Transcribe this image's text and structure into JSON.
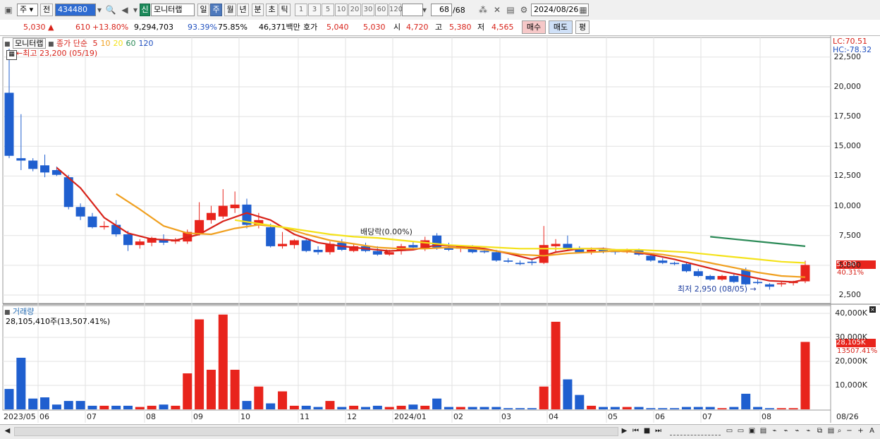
{
  "toolbar": {
    "period": "주",
    "prev_label": "전",
    "code": "434480",
    "market_badge": "신",
    "stock_name": "모니터랩",
    "tabs": [
      {
        "label": "일",
        "selected": false
      },
      {
        "label": "주",
        "selected": true
      },
      {
        "label": "월",
        "selected": false
      },
      {
        "label": "년",
        "selected": false
      },
      {
        "label": "분",
        "selected": false
      },
      {
        "label": "초",
        "selected": false
      },
      {
        "label": "틱",
        "selected": false
      }
    ],
    "intervals": [
      "1",
      "3",
      "5",
      "10",
      "20",
      "30",
      "60",
      "120"
    ],
    "count": "68",
    "total": "/68",
    "date": "2024/08/26"
  },
  "quote": {
    "price": "5,030",
    "change": "610",
    "change_pct": "+13.80%",
    "volume": "9,294,703",
    "pct1": "93.39%",
    "pct2": "75.85%",
    "amount": "46,371백만",
    "ask_label": "호가",
    "ask1": "5,040",
    "ask2": "5,030",
    "open_label": "시",
    "open": "4,720",
    "high_label": "고",
    "high": "5,380",
    "low_label": "저",
    "low": "4,565",
    "buy_label": "매수",
    "sell_label": "매도",
    "flat_label": "평"
  },
  "price_panel": {
    "name": "모니터랩",
    "legend_prefix": "종가 단순",
    "ma_labels": [
      "5",
      "10",
      "20",
      "60",
      "120"
    ],
    "ma_colors": [
      "#d8231a",
      "#f0a020",
      "#f4e21a",
      "#2b8a57",
      "#1f4fbf"
    ],
    "high_note": "최고 23,200 (05/19)",
    "low_note": "최저 2,950 (08/05)",
    "dividend_note": "배당락(0.00%)",
    "lc": "LC:70.51",
    "hc": "HC:-78.32",
    "last_price_tag": "5,030",
    "last_pct_tag": "40.31%",
    "yticks": [
      "22,500",
      "20,000",
      "17,500",
      "15,000",
      "12,500",
      "10,000",
      "7,500",
      "5,000",
      "2,500"
    ]
  },
  "volume_panel": {
    "title": "거래량",
    "summary": "28,105,410주(13,507.41%)",
    "yticks": [
      "40,000K",
      "30,000K",
      "20,000K",
      "10,000K"
    ],
    "last_vol_tag": "28,105K",
    "last_pct_tag": "13507.41%"
  },
  "xaxis": [
    "2023/05",
    "06",
    "07",
    "08",
    "09",
    "10",
    "11",
    "12",
    "2024/01",
    "02",
    "03",
    "04",
    "05",
    "06",
    "07",
    "08",
    "08/26"
  ],
  "chart_data": {
    "type": "candlestick",
    "y_range": [
      1700,
      23500
    ],
    "candles": [
      {
        "o": 19500,
        "h": 23200,
        "l": 14000,
        "c": 14200
      },
      {
        "o": 14000,
        "h": 17700,
        "l": 13000,
        "c": 13800
      },
      {
        "o": 13800,
        "h": 14000,
        "l": 12900,
        "c": 13100
      },
      {
        "o": 13400,
        "h": 14300,
        "l": 12400,
        "c": 12800
      },
      {
        "o": 13000,
        "h": 13300,
        "l": 12500,
        "c": 12600
      },
      {
        "o": 12400,
        "h": 12600,
        "l": 9700,
        "c": 9900
      },
      {
        "o": 9900,
        "h": 10200,
        "l": 8800,
        "c": 9100
      },
      {
        "o": 9100,
        "h": 9400,
        "l": 8100,
        "c": 8200
      },
      {
        "o": 8200,
        "h": 8700,
        "l": 8000,
        "c": 8300
      },
      {
        "o": 8400,
        "h": 8800,
        "l": 7400,
        "c": 7600
      },
      {
        "o": 7600,
        "h": 7900,
        "l": 6200,
        "c": 6700
      },
      {
        "o": 6700,
        "h": 7200,
        "l": 6400,
        "c": 7000
      },
      {
        "o": 6900,
        "h": 7400,
        "l": 6600,
        "c": 7300
      },
      {
        "o": 7200,
        "h": 7600,
        "l": 6700,
        "c": 6900
      },
      {
        "o": 7000,
        "h": 7300,
        "l": 6800,
        "c": 7100
      },
      {
        "o": 7000,
        "h": 8000,
        "l": 6800,
        "c": 7800
      },
      {
        "o": 7700,
        "h": 10300,
        "l": 7500,
        "c": 8800
      },
      {
        "o": 8800,
        "h": 10000,
        "l": 8500,
        "c": 9400
      },
      {
        "o": 9100,
        "h": 11400,
        "l": 8900,
        "c": 10000
      },
      {
        "o": 9800,
        "h": 11200,
        "l": 9400,
        "c": 10100
      },
      {
        "o": 10100,
        "h": 10600,
        "l": 8100,
        "c": 8400
      },
      {
        "o": 8400,
        "h": 9400,
        "l": 8100,
        "c": 8800
      },
      {
        "o": 8200,
        "h": 8500,
        "l": 6500,
        "c": 6600
      },
      {
        "o": 6600,
        "h": 7800,
        "l": 6400,
        "c": 6800
      },
      {
        "o": 6700,
        "h": 7200,
        "l": 6400,
        "c": 7100
      },
      {
        "o": 7100,
        "h": 7300,
        "l": 6100,
        "c": 6200
      },
      {
        "o": 6300,
        "h": 6600,
        "l": 5900,
        "c": 6100
      },
      {
        "o": 6100,
        "h": 7000,
        "l": 5900,
        "c": 6800
      },
      {
        "o": 6900,
        "h": 7200,
        "l": 6200,
        "c": 6300
      },
      {
        "o": 6200,
        "h": 6800,
        "l": 6100,
        "c": 6600
      },
      {
        "o": 6600,
        "h": 6900,
        "l": 6100,
        "c": 6200
      },
      {
        "o": 6200,
        "h": 6600,
        "l": 5800,
        "c": 5900
      },
      {
        "o": 5900,
        "h": 6300,
        "l": 5800,
        "c": 6100
      },
      {
        "o": 6200,
        "h": 6800,
        "l": 5900,
        "c": 6600
      },
      {
        "o": 6700,
        "h": 7000,
        "l": 6400,
        "c": 6500
      },
      {
        "o": 6400,
        "h": 7400,
        "l": 6200,
        "c": 7100
      },
      {
        "o": 7500,
        "h": 7700,
        "l": 6300,
        "c": 6500
      },
      {
        "o": 6500,
        "h": 6900,
        "l": 6200,
        "c": 6300
      },
      {
        "o": 6400,
        "h": 6700,
        "l": 6100,
        "c": 6600
      },
      {
        "o": 6600,
        "h": 6700,
        "l": 6000,
        "c": 6100
      },
      {
        "o": 6200,
        "h": 6300,
        "l": 6000,
        "c": 6100
      },
      {
        "o": 6100,
        "h": 6300,
        "l": 5300,
        "c": 5400
      },
      {
        "o": 5400,
        "h": 5600,
        "l": 5200,
        "c": 5300
      },
      {
        "o": 5200,
        "h": 5400,
        "l": 5000,
        "c": 5100
      },
      {
        "o": 5300,
        "h": 5600,
        "l": 5000,
        "c": 5200
      },
      {
        "o": 5200,
        "h": 8300,
        "l": 5100,
        "c": 6700
      },
      {
        "o": 6600,
        "h": 7200,
        "l": 6100,
        "c": 6800
      },
      {
        "o": 6800,
        "h": 7500,
        "l": 6300,
        "c": 6400
      },
      {
        "o": 6400,
        "h": 6600,
        "l": 6000,
        "c": 6100
      },
      {
        "o": 6100,
        "h": 6500,
        "l": 5900,
        "c": 6300
      },
      {
        "o": 6300,
        "h": 6500,
        "l": 6000,
        "c": 6200
      },
      {
        "o": 6200,
        "h": 6300,
        "l": 5900,
        "c": 6100
      },
      {
        "o": 6100,
        "h": 6400,
        "l": 6000,
        "c": 6300
      },
      {
        "o": 6300,
        "h": 6400,
        "l": 5800,
        "c": 5900
      },
      {
        "o": 5800,
        "h": 5900,
        "l": 5300,
        "c": 5400
      },
      {
        "o": 5400,
        "h": 5600,
        "l": 5100,
        "c": 5200
      },
      {
        "o": 5200,
        "h": 5300,
        "l": 5000,
        "c": 5100
      },
      {
        "o": 5100,
        "h": 5200,
        "l": 4400,
        "c": 4500
      },
      {
        "o": 4500,
        "h": 4700,
        "l": 4000,
        "c": 4100
      },
      {
        "o": 4100,
        "h": 4200,
        "l": 3700,
        "c": 3800
      },
      {
        "o": 3800,
        "h": 4200,
        "l": 3700,
        "c": 4100
      },
      {
        "o": 4100,
        "h": 4300,
        "l": 3500,
        "c": 3600
      },
      {
        "o": 4600,
        "h": 4800,
        "l": 3300,
        "c": 3400
      },
      {
        "o": 3600,
        "h": 3800,
        "l": 3400,
        "c": 3500
      },
      {
        "o": 3400,
        "h": 3500,
        "l": 2950,
        "c": 3200
      },
      {
        "o": 3400,
        "h": 3600,
        "l": 3200,
        "c": 3500
      },
      {
        "o": 3500,
        "h": 3700,
        "l": 3300,
        "c": 3600
      },
      {
        "o": 3650,
        "h": 5380,
        "l": 3500,
        "c": 5030
      }
    ],
    "ma_series": [
      {
        "name": "5",
        "color": "#d8231a",
        "points": [
          [
            4,
            13200
          ],
          [
            6,
            11500
          ],
          [
            8,
            9000
          ],
          [
            10,
            7700
          ],
          [
            12,
            7200
          ],
          [
            14,
            7100
          ],
          [
            16,
            7600
          ],
          [
            18,
            8700
          ],
          [
            20,
            9400
          ],
          [
            22,
            8800
          ],
          [
            24,
            7600
          ],
          [
            26,
            6900
          ],
          [
            28,
            6600
          ],
          [
            30,
            6400
          ],
          [
            32,
            6200
          ],
          [
            34,
            6300
          ],
          [
            36,
            6700
          ],
          [
            38,
            6600
          ],
          [
            40,
            6400
          ],
          [
            42,
            6000
          ],
          [
            44,
            5500
          ],
          [
            46,
            6100
          ],
          [
            48,
            6400
          ],
          [
            50,
            6400
          ],
          [
            52,
            6200
          ],
          [
            54,
            5900
          ],
          [
            56,
            5500
          ],
          [
            58,
            5000
          ],
          [
            60,
            4500
          ],
          [
            62,
            4100
          ],
          [
            64,
            3700
          ],
          [
            66,
            3600
          ],
          [
            67,
            3800
          ]
        ]
      },
      {
        "name": "10",
        "color": "#f0a020",
        "points": [
          [
            9,
            11000
          ],
          [
            11,
            9700
          ],
          [
            13,
            8300
          ],
          [
            15,
            7700
          ],
          [
            17,
            7600
          ],
          [
            19,
            8100
          ],
          [
            21,
            8400
          ],
          [
            23,
            8200
          ],
          [
            25,
            7600
          ],
          [
            27,
            7100
          ],
          [
            29,
            6800
          ],
          [
            31,
            6500
          ],
          [
            33,
            6400
          ],
          [
            35,
            6400
          ],
          [
            37,
            6500
          ],
          [
            39,
            6400
          ],
          [
            41,
            6200
          ],
          [
            43,
            5900
          ],
          [
            45,
            5800
          ],
          [
            47,
            6000
          ],
          [
            49,
            6100
          ],
          [
            51,
            6200
          ],
          [
            53,
            6100
          ],
          [
            55,
            5900
          ],
          [
            57,
            5600
          ],
          [
            59,
            5200
          ],
          [
            61,
            4800
          ],
          [
            63,
            4400
          ],
          [
            65,
            4100
          ],
          [
            67,
            4000
          ]
        ]
      },
      {
        "name": "20",
        "color": "#f4e21a",
        "points": [
          [
            19,
            8800
          ],
          [
            21,
            8500
          ],
          [
            23,
            8200
          ],
          [
            25,
            7900
          ],
          [
            27,
            7600
          ],
          [
            29,
            7400
          ],
          [
            31,
            7300
          ],
          [
            33,
            7100
          ],
          [
            35,
            6900
          ],
          [
            37,
            6700
          ],
          [
            39,
            6600
          ],
          [
            41,
            6500
          ],
          [
            43,
            6400
          ],
          [
            45,
            6400
          ],
          [
            47,
            6400
          ],
          [
            49,
            6400
          ],
          [
            51,
            6300
          ],
          [
            53,
            6300
          ],
          [
            55,
            6200
          ],
          [
            57,
            6100
          ],
          [
            59,
            5900
          ],
          [
            61,
            5700
          ],
          [
            63,
            5500
          ],
          [
            65,
            5300
          ],
          [
            67,
            5200
          ]
        ]
      },
      {
        "name": "60",
        "color": "#2b8a57",
        "points": [
          [
            59,
            7400
          ],
          [
            61,
            7200
          ],
          [
            63,
            7000
          ],
          [
            65,
            6800
          ],
          [
            67,
            6600
          ]
        ]
      }
    ],
    "volume_range": [
      0,
      42000
    ],
    "volumes": [
      8500,
      21500,
      4500,
      5000,
      2000,
      3500,
      3500,
      1500,
      1500,
      1500,
      1500,
      1000,
      1500,
      2000,
      1500,
      15000,
      37500,
      16500,
      39500,
      16500,
      3500,
      9500,
      2500,
      7500,
      1500,
      1500,
      1000,
      3500,
      1000,
      1500,
      1000,
      1500,
      1000,
      1500,
      2000,
      1500,
      4500,
      1000,
      1000,
      1000,
      1000,
      1000,
      500,
      500,
      500,
      9500,
      36500,
      12500,
      6000,
      1500,
      1000,
      1000,
      1000,
      1000,
      500,
      500,
      500,
      1000,
      1000,
      1000,
      500,
      1000,
      6500,
      1000,
      500,
      500,
      500,
      28105
    ]
  }
}
